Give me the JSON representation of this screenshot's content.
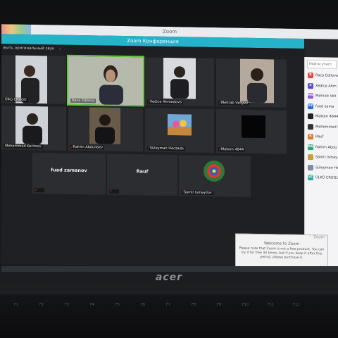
{
  "window": {
    "title": "Zoom",
    "conference_title": "Zoom Конференция",
    "toolbar_text": "жить оригинальный звук"
  },
  "tiles": [
    {
      "name": "Ülkü CRUGU",
      "type": "photo",
      "bg": "#cfd2d6",
      "active": false
    },
    {
      "name": "Raca Edilova",
      "type": "photo",
      "bg": "#b9bdb0",
      "active": true
    },
    {
      "name": "Xedice Ahmedova",
      "type": "photo",
      "bg": "#d8dade",
      "active": false
    },
    {
      "name": "Mehrab Veliyev",
      "type": "photo",
      "bg": "#b5a89c",
      "active": false
    },
    {
      "name": "Mehemmed Kerimov",
      "type": "photo",
      "bg": "#cdd0d4",
      "active": false
    },
    {
      "name": "Rahim Abdullaev",
      "type": "photo",
      "bg": "#6a5a4a",
      "active": false
    },
    {
      "name": "Süleyman Heczada",
      "type": "photo",
      "bg": "#2e2f33",
      "active": false
    },
    {
      "name": "Makom 4844",
      "type": "photo",
      "bg": "#2e2f33",
      "active": false
    },
    {
      "name": "fuad zamanov",
      "type": "name",
      "active": false
    },
    {
      "name": "Rauf",
      "type": "name",
      "active": false
    },
    {
      "name": "Samir Ismayilov",
      "type": "photo",
      "bg": "#2e2f33",
      "active": false
    }
  ],
  "panel": {
    "search_placeholder": "Найти участ",
    "participants": [
      {
        "initials": "R",
        "name": "Raca Edilova",
        "color": "#e04a3b"
      },
      {
        "initials": "X",
        "name": "Xedice Ahm",
        "color": "#5b4bd6"
      },
      {
        "initials": "MV",
        "name": "Mehrab Veli",
        "color": "#8e5bc9"
      },
      {
        "initials": "FZ",
        "name": "fuad zama",
        "color": "#2a6bd6"
      },
      {
        "initials": "",
        "name": "Makom 4844",
        "color": "#222222"
      },
      {
        "initials": "",
        "name": "Mehemmed K",
        "color": "#333333"
      },
      {
        "initials": "R",
        "name": "Rauf",
        "color": "#e07a2b"
      },
      {
        "initials": "RA",
        "name": "Rahim Abdu",
        "color": "#29a86a"
      },
      {
        "initials": "",
        "name": "Samir Ismay",
        "color": "#c4a03a"
      },
      {
        "initials": "",
        "name": "Süleyman He",
        "color": "#7a8da0"
      },
      {
        "initials": "VC",
        "name": "ÜLKÜ CRUGU",
        "color": "#2bb0a0"
      }
    ]
  },
  "popup": {
    "title": "Zoom",
    "heading": "Welcome to Zoom",
    "body": "Please note that Zoom is not a free product. You can try it for free 30 times, but if you keep it after this period, please purchase it."
  },
  "laptop": {
    "brand": "acer",
    "keys": [
      "F1",
      "F2",
      "F3",
      "F4",
      "F5",
      "F6",
      "F7",
      "F8",
      "F9",
      "F10",
      "F11",
      "F12"
    ]
  }
}
